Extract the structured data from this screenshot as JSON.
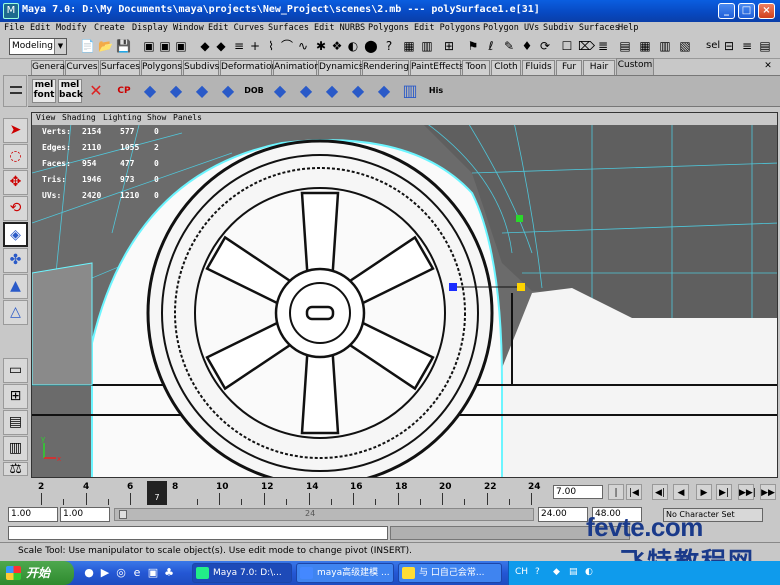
{
  "window": {
    "title": "Maya 7.0: D:\\My Documents\\maya\\projects\\New_Project\\scenes\\2.mb   ---   polySurface1.e[31]",
    "min_symbol": "_",
    "max_symbol": "□",
    "close_symbol": "×"
  },
  "menubar": [
    "File",
    "Edit",
    "Modify",
    "Create",
    "Display",
    "Window",
    "Edit Curves",
    "Surfaces",
    "Edit NURBS",
    "Polygons",
    "Edit Polygons",
    "Polygon UVs",
    "Subdiv Surfaces",
    "Help"
  ],
  "statusline": {
    "mode": "Modeling",
    "sel_label": "sel"
  },
  "shelf": {
    "tabs": [
      "General",
      "Curves",
      "Surfaces",
      "Polygons",
      "Subdivs",
      "Deformation",
      "Animation",
      "Dynamics",
      "Rendering",
      "PaintEffects",
      "Toon",
      "Cloth",
      "Fluids",
      "Fur",
      "Hair",
      "Custom"
    ],
    "active_tab": "Custom",
    "items": [
      {
        "icon": "mel-font-icon",
        "label": "mel\nfont"
      },
      {
        "icon": "mel-back-icon",
        "label": "mel\nback"
      },
      {
        "icon": "cross-icon",
        "label": ""
      },
      {
        "icon": "cp-icon",
        "label": "CP"
      },
      {
        "icon": "cube-icon",
        "label": ""
      },
      {
        "icon": "cube-icon",
        "label": ""
      },
      {
        "icon": "cube-icon",
        "label": ""
      },
      {
        "icon": "cube-icon",
        "label": ""
      },
      {
        "icon": "dob-icon",
        "label": "DOB"
      },
      {
        "icon": "cube-icon",
        "label": ""
      },
      {
        "icon": "cube-icon",
        "label": ""
      },
      {
        "icon": "cube-icon",
        "label": ""
      },
      {
        "icon": "cube-icon",
        "label": ""
      },
      {
        "icon": "cube-icon",
        "label": ""
      },
      {
        "icon": "ladder-icon",
        "label": ""
      },
      {
        "icon": "his-icon",
        "label": "His"
      }
    ]
  },
  "viewport": {
    "menu": [
      "View",
      "Shading",
      "Lighting",
      "Show",
      "Panels"
    ],
    "hud": [
      {
        "label": "Verts:",
        "a": "2154",
        "b": "577",
        "c": "0"
      },
      {
        "label": "Edges:",
        "a": "2110",
        "b": "1055",
        "c": "2"
      },
      {
        "label": "Faces:",
        "a": "954",
        "b": "477",
        "c": "0"
      },
      {
        "label": "Tris:",
        "a": "1946",
        "b": "973",
        "c": "0"
      },
      {
        "label": "UVs:",
        "a": "2420",
        "b": "1210",
        "c": "0"
      }
    ],
    "axis_y": "y",
    "axis_x": "x",
    "colors": {
      "background": "#6b6b6b",
      "highlight": "#6cf5ff",
      "wire": "#111111"
    }
  },
  "timeline": {
    "ticks": [
      "2",
      "4",
      "6",
      "8",
      "10",
      "12",
      "14",
      "16",
      "18",
      "20",
      "22",
      "24"
    ],
    "current_frame": "7",
    "current_field": "7.00",
    "buttons": [
      "|◀◀",
      "|◀",
      "◀|",
      "◀",
      "▶",
      "▶|",
      "▶▶|",
      "▶▶"
    ]
  },
  "range": {
    "start": "1.00",
    "start2": "1.00",
    "end": "24.00",
    "end2": "48.00",
    "inner_label": "24",
    "charset": "No Character Set"
  },
  "helpline": {
    "text": "Scale Tool: Use manipulator to scale object(s). Use edit mode to change pivot (INSERT)."
  },
  "watermark": {
    "line1": "fevte.com",
    "line2": "飞特教程网"
  },
  "taskbar": {
    "start_label": "开始",
    "tasks": [
      {
        "label": "Maya 7.0: D:\\...",
        "active": true
      },
      {
        "label": "maya高级建模 ...",
        "active": false
      },
      {
        "label": "与 口自己会常...",
        "active": false
      }
    ],
    "tray": [
      "CH"
    ]
  }
}
